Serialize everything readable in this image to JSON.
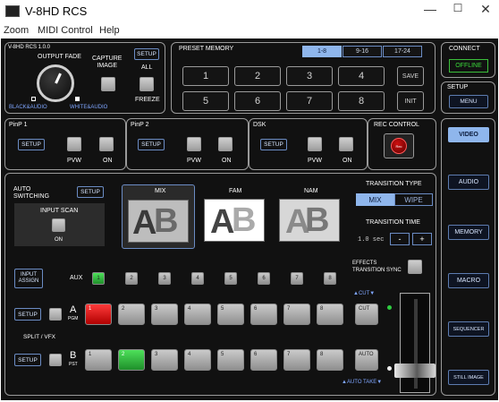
{
  "window": {
    "title": "V-8HD RCS",
    "minimize": "—",
    "maximize": "☐",
    "close": "✕"
  },
  "menu": [
    "Zoom",
    "MIDI Control",
    "Help"
  ],
  "top": {
    "version": "V-8HD RCS 1.0.0",
    "output_fade": "OUTPUT FADE",
    "setup": "SETUP",
    "capture_image": "CAPTURE\nIMAGE",
    "all": "ALL",
    "freeze": "FREEZE",
    "black_audio": "BLACK&AUDIO",
    "white_audio": "WHITE&AUDIO"
  },
  "preset": {
    "title": "PRESET MEMORY",
    "tabs": [
      "1-8",
      "9-16",
      "17-24"
    ],
    "buttons": [
      "1",
      "2",
      "3",
      "4",
      "5",
      "6",
      "7",
      "8"
    ],
    "save": "SAVE",
    "init": "INIT"
  },
  "connect": {
    "title": "CONNECT",
    "status": "OFFLINE"
  },
  "setup_box": {
    "title": "SETUP",
    "menu": "MENU"
  },
  "right_nav": [
    "VIDEO",
    "AUDIO",
    "MEMORY",
    "MACRO",
    "SEQUENCER",
    "STILL IMAGE"
  ],
  "pinp1": {
    "title": "PinP 1",
    "setup": "SETUP",
    "pvw": "PVW",
    "on": "ON"
  },
  "pinp2": {
    "title": "PinP 2",
    "setup": "SETUP",
    "pvw": "PVW",
    "on": "ON"
  },
  "dsk": {
    "title": "DSK",
    "setup": "SETUP",
    "pvw": "PVW",
    "on": "ON"
  },
  "rec": {
    "title": "REC CONTROL",
    "button": "Rec"
  },
  "auto_switching": {
    "label": "AUTO\nSWITCHING",
    "setup": "SETUP",
    "input_scan": "INPUT SCAN",
    "on": "ON"
  },
  "transitions": {
    "mix": "MIX",
    "fam": "FAM",
    "nam": "NAM"
  },
  "transition_type": {
    "title": "TRANSITION TYPE",
    "mix": "MIX",
    "wipe": "WIPE"
  },
  "transition_time": {
    "title": "TRANSITION TIME",
    "value": "1.0 sec",
    "minus": "-",
    "plus": "+"
  },
  "effects": "EFFECTS\nTRANSITION SYNC",
  "input_assign": "INPUT\nASSIGN",
  "aux": {
    "label": "AUX",
    "buttons": [
      "1",
      "2",
      "3",
      "4",
      "5",
      "6",
      "7",
      "8"
    ],
    "active": "1"
  },
  "a_bus": {
    "setup": "SETUP",
    "letter": "A",
    "sub": "PGM",
    "buttons": [
      "1",
      "2",
      "3",
      "4",
      "5",
      "6",
      "7",
      "8"
    ],
    "active": "1"
  },
  "b_bus": {
    "setup": "SETUP",
    "letter": "B",
    "sub": "PST",
    "buttons": [
      "1",
      "2",
      "3",
      "4",
      "5",
      "6",
      "7",
      "8"
    ],
    "active": "2"
  },
  "split_vfx": "SPLIT / VFX",
  "cut": "CUT",
  "auto": "AUTO",
  "cut_arrow": "▲CUT▼",
  "auto_take": "▲AUTO TAKE▼",
  "colors": {
    "red": "#ff1e1e",
    "green": "#2ecc40",
    "accent": "#6b8cc4"
  }
}
